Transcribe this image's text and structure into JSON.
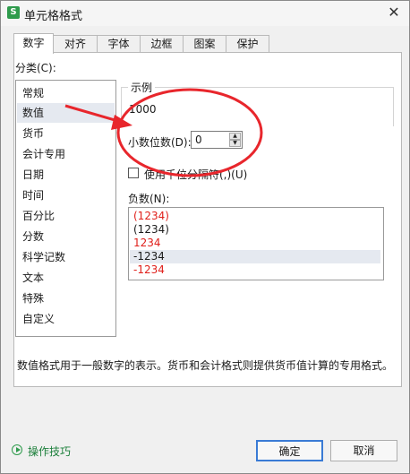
{
  "window": {
    "app_icon": "S",
    "title": "单元格格式",
    "close_glyph": "✕"
  },
  "tabs": [
    {
      "label": "数字",
      "active": true
    },
    {
      "label": "对齐"
    },
    {
      "label": "字体"
    },
    {
      "label": "边框"
    },
    {
      "label": "图案"
    },
    {
      "label": "保护"
    }
  ],
  "category": {
    "label": "分类(C):",
    "items": [
      "常规",
      "数值",
      "货币",
      "会计专用",
      "日期",
      "时间",
      "百分比",
      "分数",
      "科学记数",
      "文本",
      "特殊",
      "自定义"
    ],
    "selected": "数值"
  },
  "sample": {
    "title": "示例",
    "value": "1000"
  },
  "decimal": {
    "label": "小数位数(D):",
    "value": "0",
    "up_glyph": "▲",
    "down_glyph": "▼"
  },
  "thousands": {
    "label": "使用千位分隔符(,)(U)",
    "checked": false
  },
  "negative": {
    "label": "负数(N):",
    "items": [
      {
        "text": "(1234)",
        "color": "#e0201b"
      },
      {
        "text": "(1234)",
        "color": "#1a1a1a"
      },
      {
        "text": "1234",
        "color": "#e0201b"
      },
      {
        "text": "-1234",
        "color": "#1a1a1a",
        "selected": true
      },
      {
        "text": "-1234",
        "color": "#e0201b"
      }
    ]
  },
  "description": "数值格式用于一般数字的表示。货币和会计格式则提供货币值计算的专用格式。",
  "footer": {
    "help_label": "操作技巧",
    "ok_label": "确定",
    "cancel_label": "取消"
  },
  "colors": {
    "annotation_red": "#e8262c",
    "accent_green": "#2e9b4c",
    "focus_blue": "#3a7bd5"
  }
}
